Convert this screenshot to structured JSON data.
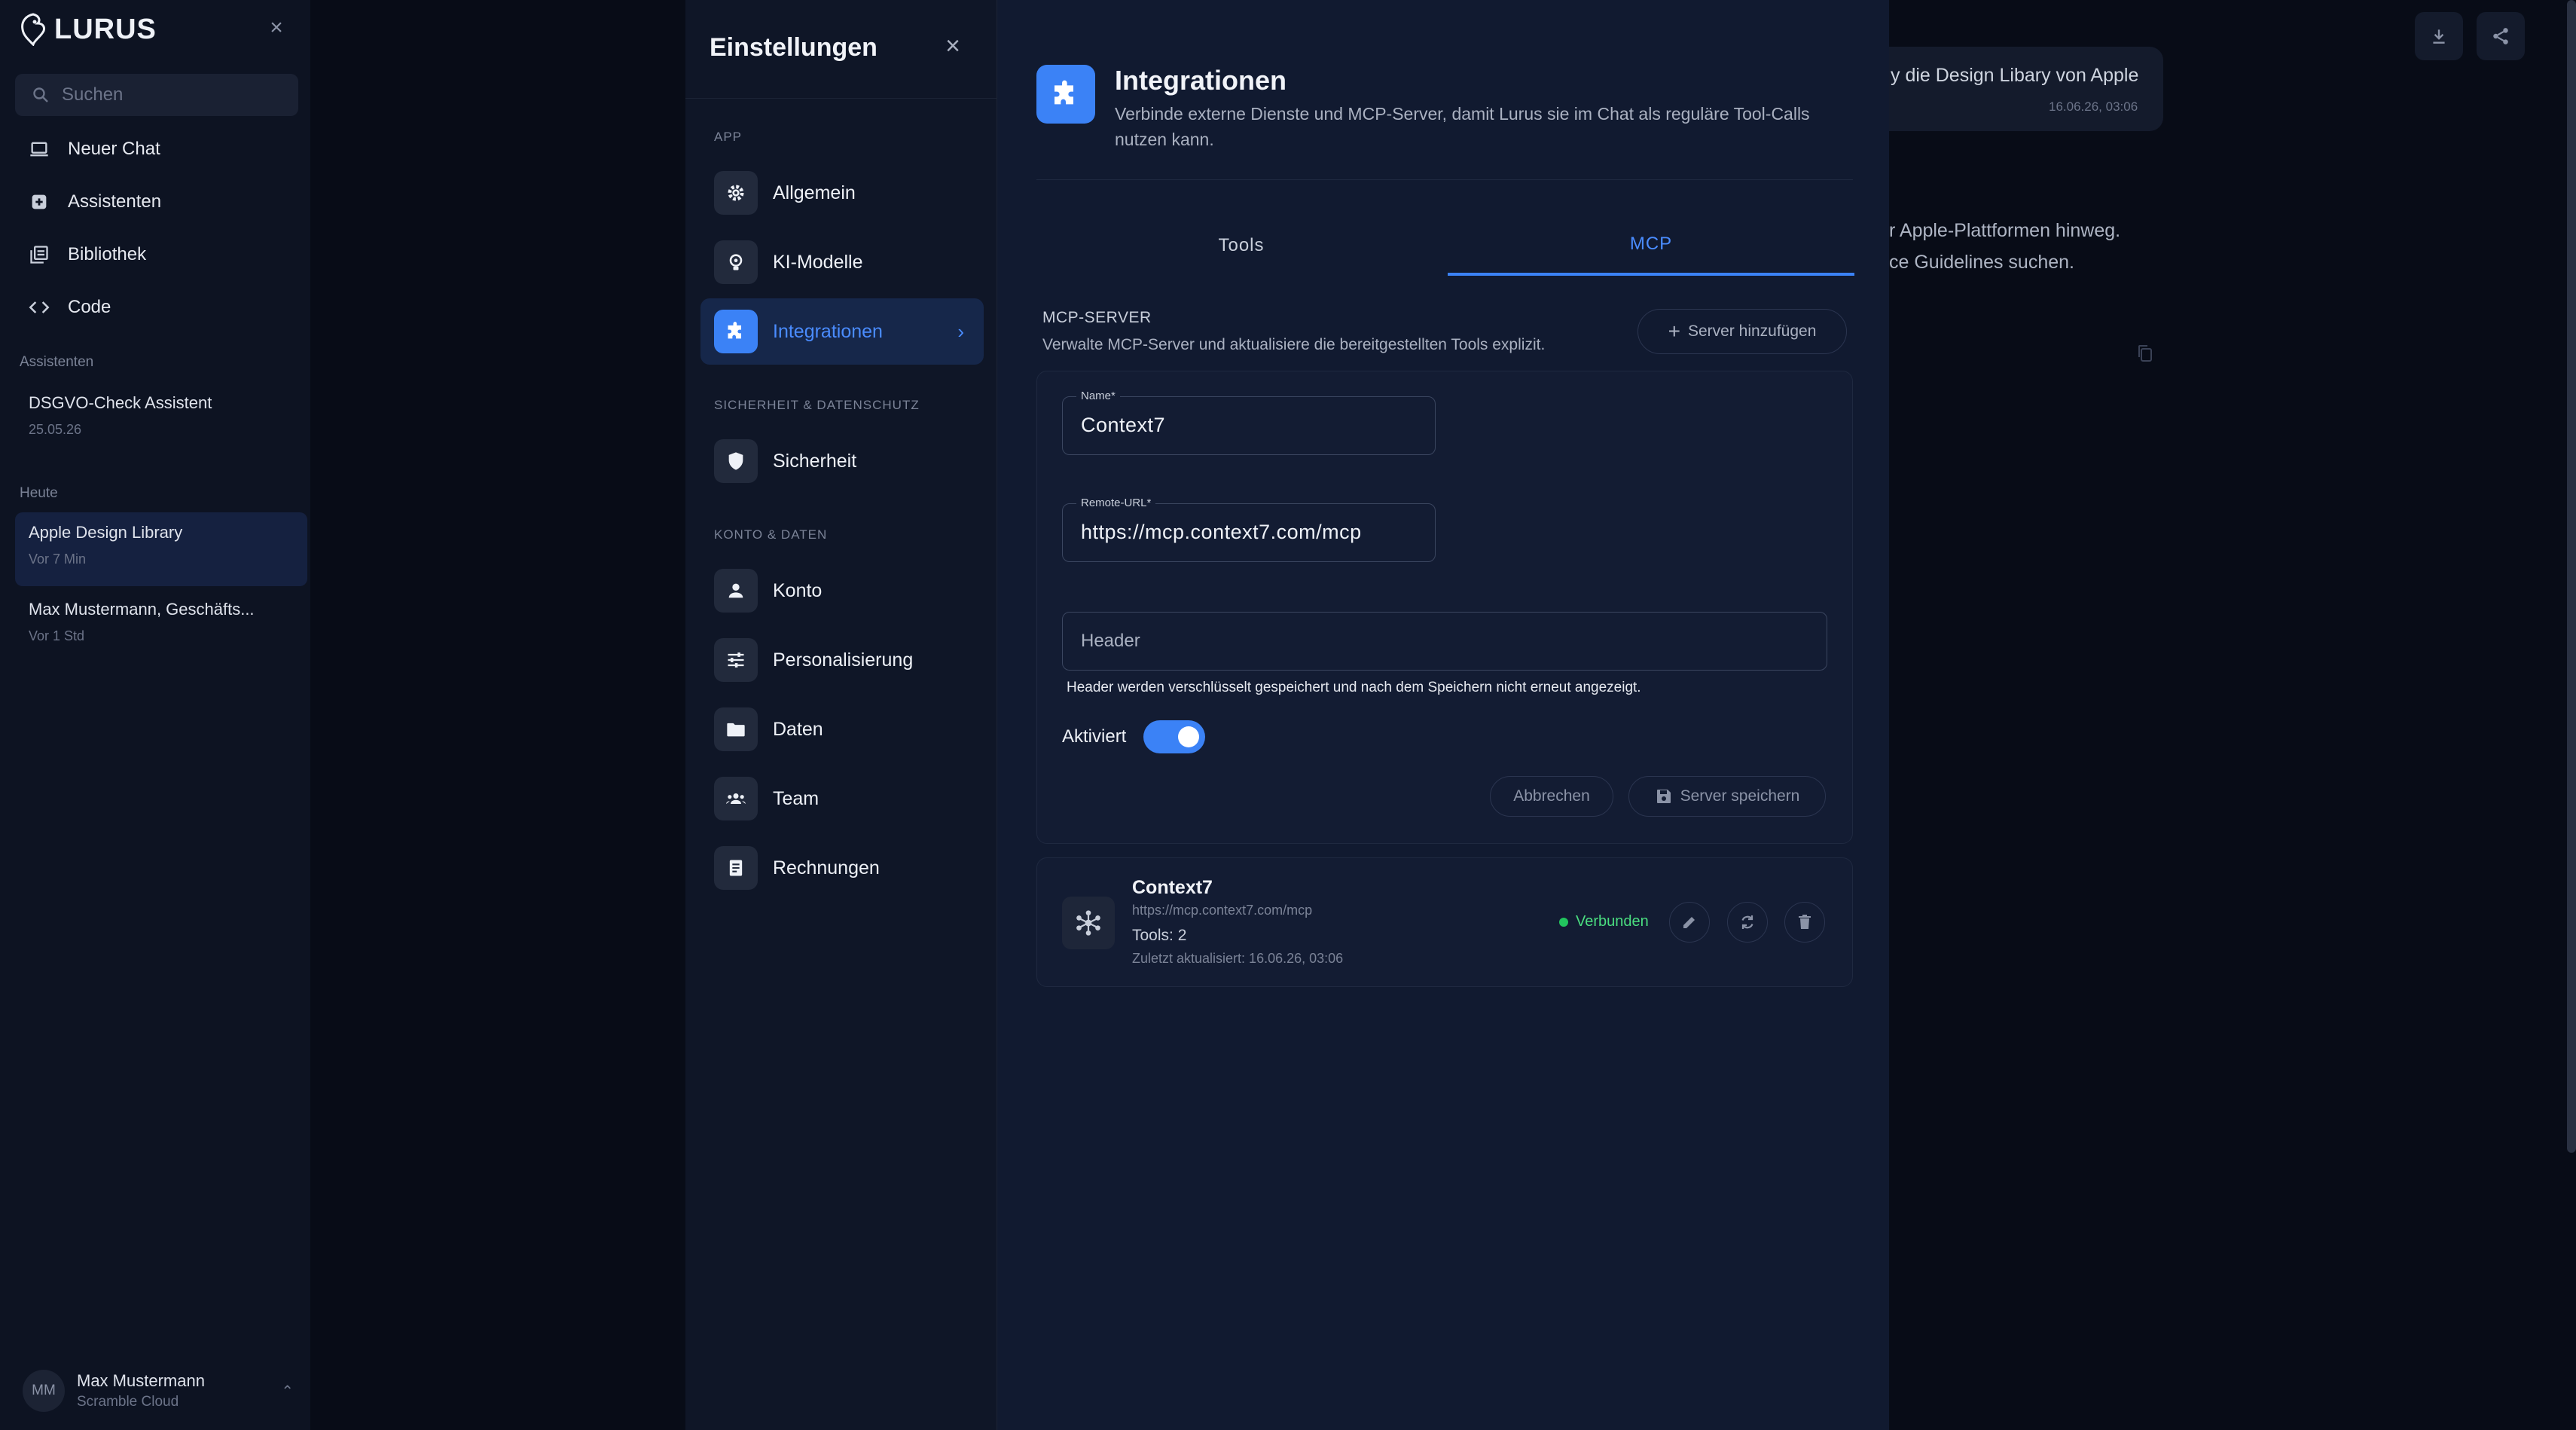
{
  "sidebar": {
    "logo_text": "LURUS",
    "search_placeholder": "Suchen",
    "nav": [
      {
        "label": "Neuer Chat",
        "icon": "laptop-icon"
      },
      {
        "label": "Assistenten",
        "icon": "assistant-icon"
      },
      {
        "label": "Bibliothek",
        "icon": "library-icon"
      },
      {
        "label": "Code",
        "icon": "code-icon"
      }
    ],
    "section_assistants": "Assistenten",
    "assistant": {
      "title": "DSGVO-Check Assistent",
      "date": "25.05.26"
    },
    "section_today": "Heute",
    "conversations": [
      {
        "title": "Apple Design Library",
        "time": "Vor 7 Min",
        "active": true
      },
      {
        "title": "Max Mustermann, Geschäfts...",
        "time": "Vor 1 Std",
        "active": false
      }
    ],
    "user": {
      "initials": "MM",
      "name": "Max Mustermann",
      "org": "Scramble Cloud"
    }
  },
  "background_chat": {
    "bubble_text": "y die Design Libary von Apple",
    "bubble_time": "16.06.26, 03:06",
    "line1": "r Apple-Plattformen hinweg.",
    "line2": "ce Guidelines suchen."
  },
  "settings": {
    "title": "Einstellungen",
    "sections": [
      {
        "heading": "APP",
        "items": [
          "Allgemein",
          "KI-Modelle",
          "Integrationen"
        ]
      },
      {
        "heading": "SICHERHEIT & DATENSCHUTZ",
        "items": [
          "Sicherheit"
        ]
      },
      {
        "heading": "KONTO & DATEN",
        "items": [
          "Konto",
          "Personalisierung",
          "Daten",
          "Team",
          "Rechnungen"
        ]
      }
    ],
    "active_item": "Integrationen"
  },
  "integrations": {
    "title": "Integrationen",
    "description": "Verbinde externe Dienste und MCP-Server, damit Lurus sie im Chat als reguläre Tool-Calls nutzen kann.",
    "tabs": [
      "Tools",
      "MCP"
    ],
    "active_tab": "MCP",
    "mcp": {
      "heading": "MCP-SERVER",
      "subtitle": "Verwalte MCP-Server und aktualisiere die bereitgestellten Tools explizit.",
      "add_button": "Server hinzufügen",
      "form": {
        "name_label": "Name*",
        "name_value": "Context7",
        "url_label": "Remote-URL*",
        "url_value": "https://mcp.context7.com/mcp",
        "header_placeholder": "Header",
        "header_hint": "Header werden verschlüsselt gespeichert und nach dem Speichern nicht erneut angezeigt.",
        "toggle_label": "Aktiviert",
        "toggle_on": true,
        "cancel": "Abbrechen",
        "save": "Server speichern"
      },
      "server": {
        "name": "Context7",
        "url": "https://mcp.context7.com/mcp",
        "tools": "Tools: 2",
        "updated": "Zuletzt aktualisiert: 16.06.26, 03:06",
        "status": "Verbunden"
      }
    }
  },
  "colors": {
    "accent": "#3b82f6",
    "success": "#22c55e"
  }
}
